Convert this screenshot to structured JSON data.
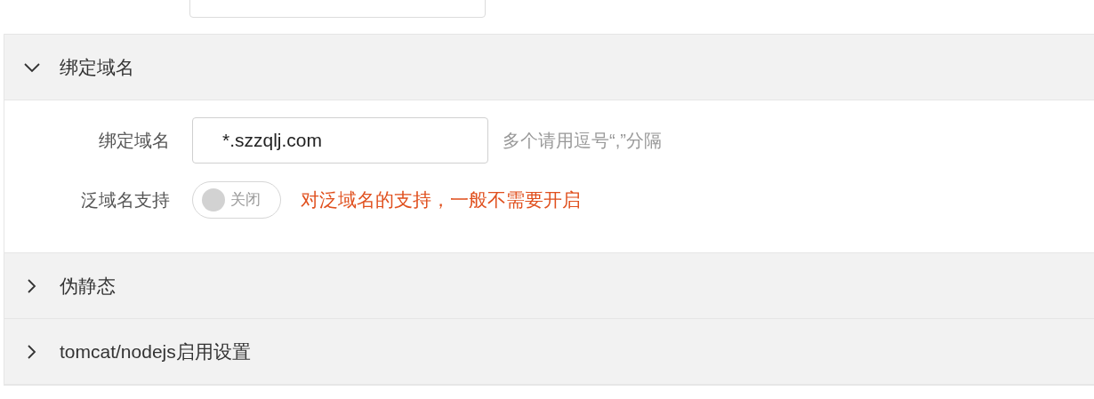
{
  "sections": [
    {
      "title": "绑定域名",
      "expanded": true,
      "fields": [
        {
          "kind": "text",
          "label": "绑定域名",
          "value": "*.szzqlj.com",
          "hint": "多个请用逗号“,”分隔"
        },
        {
          "kind": "switch",
          "label": "泛域名支持",
          "on": false,
          "switch_label": "关闭",
          "hint": "对泛域名的支持，一般不需要开启"
        }
      ]
    },
    {
      "title": "伪静态",
      "expanded": false
    },
    {
      "title": "tomcat/nodejs启用设置",
      "expanded": false
    }
  ]
}
